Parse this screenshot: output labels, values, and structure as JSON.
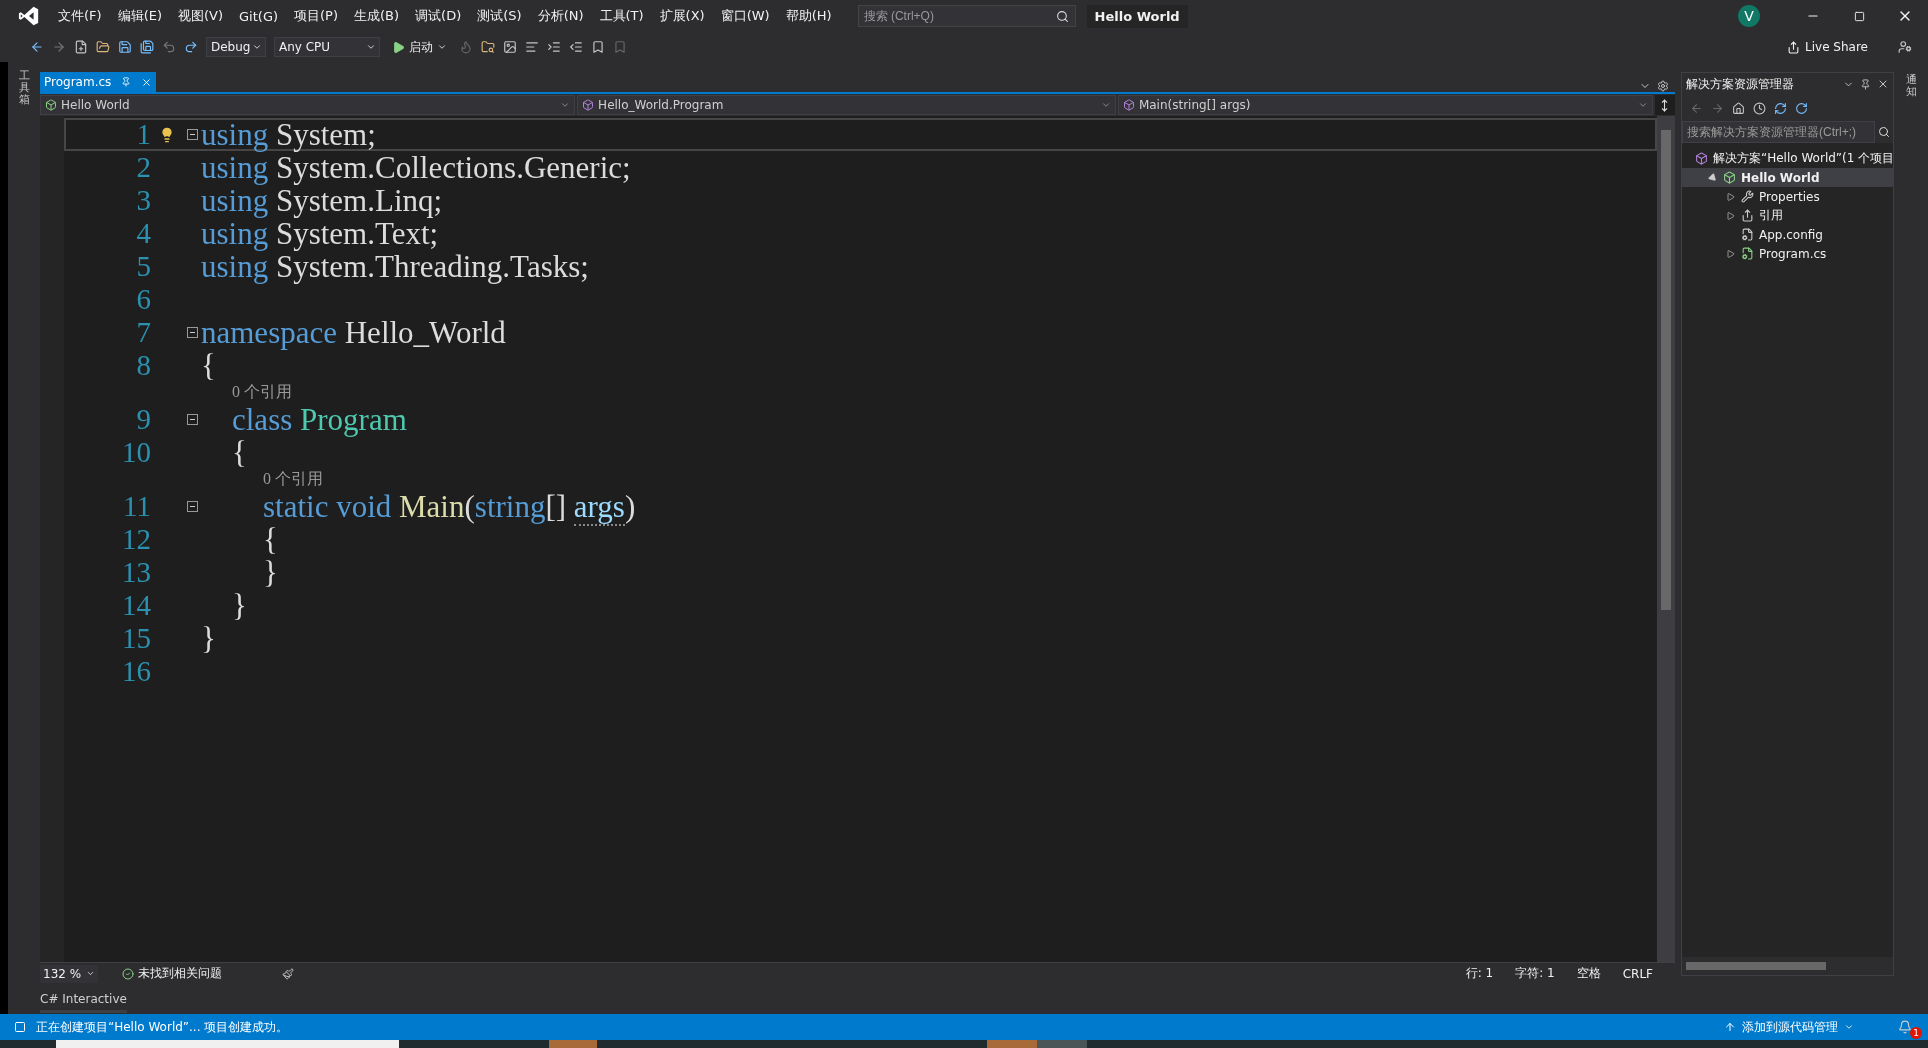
{
  "menu": [
    "文件(F)",
    "编辑(E)",
    "视图(V)",
    "Git(G)",
    "项目(P)",
    "生成(B)",
    "调试(D)",
    "测试(S)",
    "分析(N)",
    "工具(T)",
    "扩展(X)",
    "窗口(W)",
    "帮助(H)"
  ],
  "search": {
    "placeholder": "搜索 (Ctrl+Q)"
  },
  "window": {
    "title": "Hello World",
    "avatar": "V"
  },
  "toolbar": {
    "configuration": "Debug",
    "platform": "Any CPU",
    "run": "启动",
    "live_share": "Live Share"
  },
  "toolbox_label": "工具箱",
  "notifications_label": "通知",
  "tabs": [
    {
      "label": "Program.cs",
      "selected": true
    }
  ],
  "nav": [
    "Hello World",
    "Hello_World.Program",
    "Main(string[] args)"
  ],
  "code": [
    {
      "num": "1",
      "current": true,
      "fold": true,
      "tokens": [
        {
          "kind": "keyword",
          "text": "using"
        },
        {
          "kind": "plain",
          "text": " System;"
        }
      ]
    },
    {
      "num": "2",
      "current": false,
      "fold": false,
      "tokens": [
        {
          "kind": "keyword",
          "text": "using"
        },
        {
          "kind": "plain",
          "text": " System.Collections.Generic;"
        }
      ]
    },
    {
      "num": "3",
      "current": false,
      "fold": false,
      "tokens": [
        {
          "kind": "keyword",
          "text": "using"
        },
        {
          "kind": "plain",
          "text": " System.Linq;"
        }
      ]
    },
    {
      "num": "4",
      "current": false,
      "fold": false,
      "tokens": [
        {
          "kind": "keyword",
          "text": "using"
        },
        {
          "kind": "plain",
          "text": " System.Text;"
        }
      ]
    },
    {
      "num": "5",
      "current": false,
      "fold": false,
      "tokens": [
        {
          "kind": "keyword",
          "text": "using"
        },
        {
          "kind": "plain",
          "text": " System.Threading.Tasks;"
        }
      ]
    },
    {
      "num": "6",
      "current": false,
      "fold": false
    },
    {
      "num": "7",
      "current": false,
      "fold": true,
      "tokens": [
        {
          "kind": "keyword",
          "text": "namespace"
        },
        {
          "kind": "plain",
          "text": " Hello_World"
        }
      ]
    },
    {
      "num": "8",
      "current": false,
      "fold": false,
      "tokens": [
        {
          "kind": "plain",
          "text": "{"
        }
      ]
    },
    {
      "num": "9",
      "current": false,
      "fold": true,
      "codelens": "0 个引用",
      "tokens": [
        {
          "kind": "keyword",
          "text": "    class"
        },
        {
          "kind": "type",
          "text": " Program"
        }
      ]
    },
    {
      "num": "10",
      "current": false,
      "fold": false,
      "tokens": [
        {
          "kind": "plain",
          "text": "    {"
        }
      ]
    },
    {
      "num": "11",
      "current": false,
      "fold": true,
      "codelens": "0 个引用",
      "tokens": [
        {
          "kind": "keyword",
          "text": "        static"
        },
        {
          "kind": "keyword",
          "text": " void"
        },
        {
          "kind": "method",
          "text": " Main"
        },
        {
          "kind": "plain",
          "text": "("
        },
        {
          "kind": "keyword",
          "text": "string"
        },
        {
          "kind": "plain",
          "text": "[] "
        },
        {
          "kind": "param",
          "text": "args"
        },
        {
          "kind": "plain",
          "text": ")"
        }
      ]
    },
    {
      "num": "12",
      "current": false,
      "fold": false,
      "tokens": [
        {
          "kind": "plain",
          "text": "        {"
        }
      ]
    },
    {
      "num": "13",
      "current": false,
      "fold": false,
      "tokens": [
        {
          "kind": "plain",
          "text": "        }"
        }
      ]
    },
    {
      "num": "14",
      "current": false,
      "fold": false,
      "tokens": [
        {
          "kind": "plain",
          "text": "    }"
        }
      ]
    },
    {
      "num": "15",
      "current": false,
      "fold": false,
      "tokens": [
        {
          "kind": "plain",
          "text": "}"
        }
      ]
    },
    {
      "num": "16",
      "current": false,
      "fold": false
    }
  ],
  "editor_status": {
    "zoom": "132 %",
    "issues": "未找到相关问题",
    "position": [
      "行: 1",
      "字符: 1",
      "空格",
      "CRLF"
    ]
  },
  "bottom_tab": "C# Interactive",
  "solution_explorer": {
    "title": "解决方案资源管理器",
    "search_placeholder": "搜索解决方案资源管理器(Ctrl+;)",
    "tree": [
      {
        "label": "解决方案“Hello World”(1 个项目",
        "kind": "solution",
        "selected": false,
        "children": [
          {
            "label": "Hello World",
            "kind": "project",
            "selected": true,
            "expanded": true,
            "children": [
              {
                "label": "Properties",
                "kind": "properties",
                "selected": false,
                "expanded": false
              },
              {
                "label": "引用",
                "kind": "references",
                "selected": false,
                "expanded": false
              },
              {
                "label": "App.config",
                "kind": "config",
                "selected": false
              },
              {
                "label": "Program.cs",
                "kind": "csfile",
                "selected": false,
                "expanded": false
              }
            ]
          }
        ]
      }
    ]
  },
  "status_bar": {
    "message": "正在创建项目“Hello World”... 项目创建成功。",
    "source_control": "添加到源代码管理",
    "notification_count": "1"
  }
}
